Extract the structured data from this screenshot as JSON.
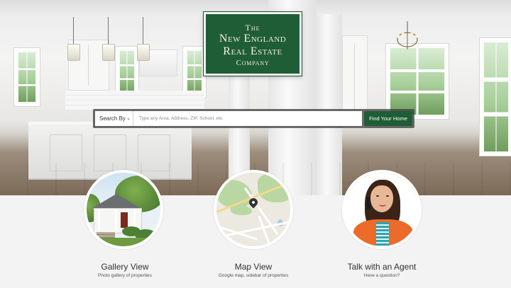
{
  "logo": {
    "line1": "The",
    "line2": "New England",
    "line3": "Real Estate",
    "line4": "Company",
    "color": "#1f5d36"
  },
  "search": {
    "by_label": "Search By",
    "by_icon": "chevron-down-icon",
    "placeholder": "Type any Area, Address, ZIP, School, etc.",
    "value": "",
    "button_label": "Find Your Home",
    "button_color": "#1f5d36"
  },
  "cards": [
    {
      "title": "Gallery View",
      "subtitle": "Photo gallery of properties",
      "image": "house-photo"
    },
    {
      "title": "Map View",
      "subtitle": "Google map, sidebar of properties",
      "image": "map-thumbnail",
      "icon": "map-pin-icon"
    },
    {
      "title": "Talk with an Agent",
      "subtitle": "Have a question?",
      "image": "agent-photo"
    }
  ],
  "hero": {
    "image": "white-kitchen-photo"
  }
}
